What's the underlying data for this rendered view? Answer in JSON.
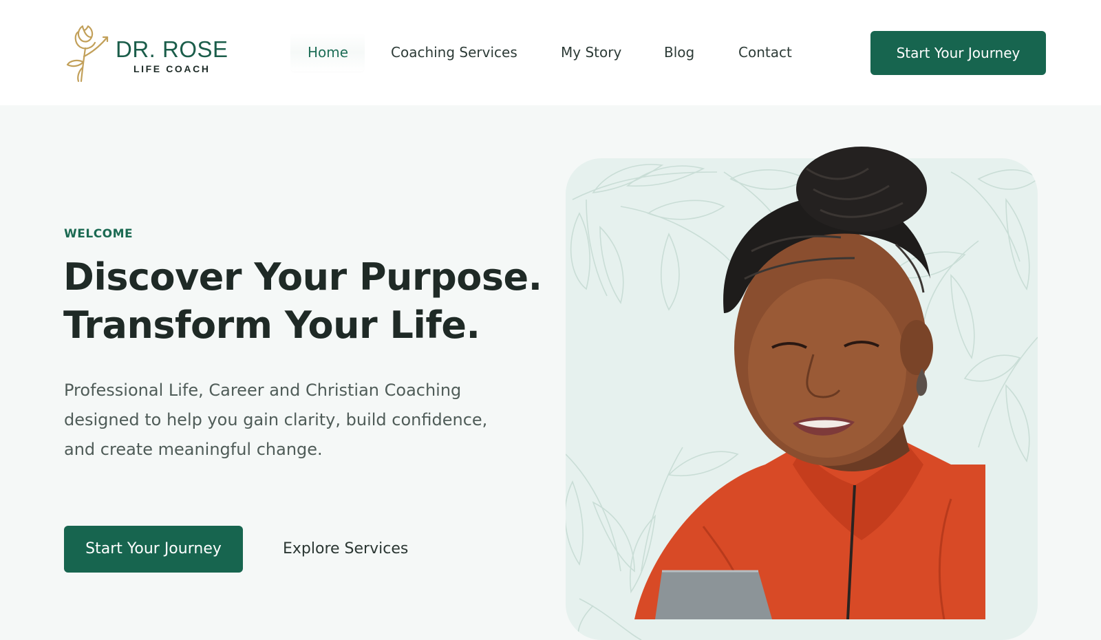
{
  "brand": {
    "name": "DR. ROSE",
    "tagline": "LIFE COACH",
    "logo_icon": "rose-icon",
    "accent_color": "#17654f",
    "gold_color": "#c2a05a"
  },
  "nav": {
    "items": [
      {
        "label": "Home",
        "active": true
      },
      {
        "label": "Coaching Services",
        "active": false
      },
      {
        "label": "My Story",
        "active": false
      },
      {
        "label": "Blog",
        "active": false
      },
      {
        "label": "Contact",
        "active": false
      }
    ],
    "cta_label": "Start Your Journey"
  },
  "hero": {
    "eyebrow": "WELCOME",
    "headline_line1": "Discover Your Purpose.",
    "headline_line2": "Transform Your Life.",
    "description": "Professional Life, Career and Christian Coaching designed to help you gain clarity, build confidence, and create meaningful change.",
    "primary_cta": "Start Your Journey",
    "secondary_cta": "Explore Services",
    "image": "portrait-photo"
  }
}
